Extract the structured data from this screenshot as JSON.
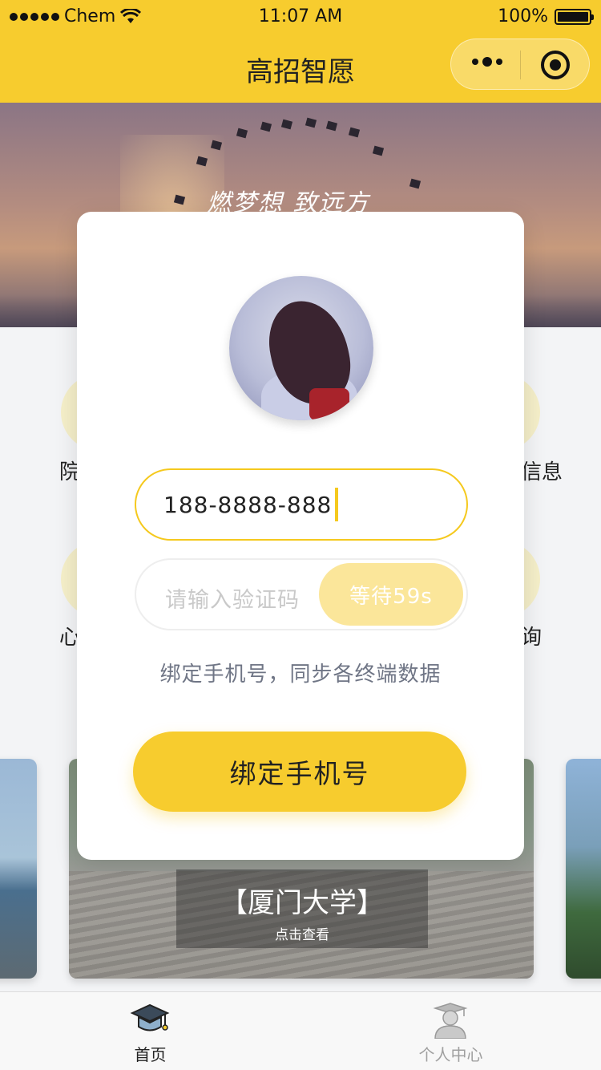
{
  "status_bar": {
    "carrier": "Chem",
    "time": "11:07 AM",
    "battery": "100%"
  },
  "nav": {
    "title": "高招智愿"
  },
  "banner": {
    "slogan": "燃梦想 致远方"
  },
  "grid": {
    "items": [
      {
        "label": "院"
      },
      {
        "label": "信息"
      },
      {
        "label": "心"
      },
      {
        "label": "询"
      }
    ]
  },
  "card": {
    "title": "【厦门大学】",
    "subtitle": "点击查看"
  },
  "modal": {
    "phone_value": "188-8888-888",
    "code_placeholder": "请输入验证码",
    "code_button": "等待59s",
    "hint": "绑定手机号，同步各终端数据",
    "bind_button": "绑定手机号"
  },
  "tabbar": {
    "tabs": [
      {
        "label": "首页",
        "active": true,
        "icon": "graduation-cap-icon"
      },
      {
        "label": "个人中心",
        "active": false,
        "icon": "graduate-person-icon"
      }
    ]
  },
  "colors": {
    "accent": "#f7cc2e",
    "accent_light": "#fbe69a",
    "hint": "#6f7585"
  }
}
